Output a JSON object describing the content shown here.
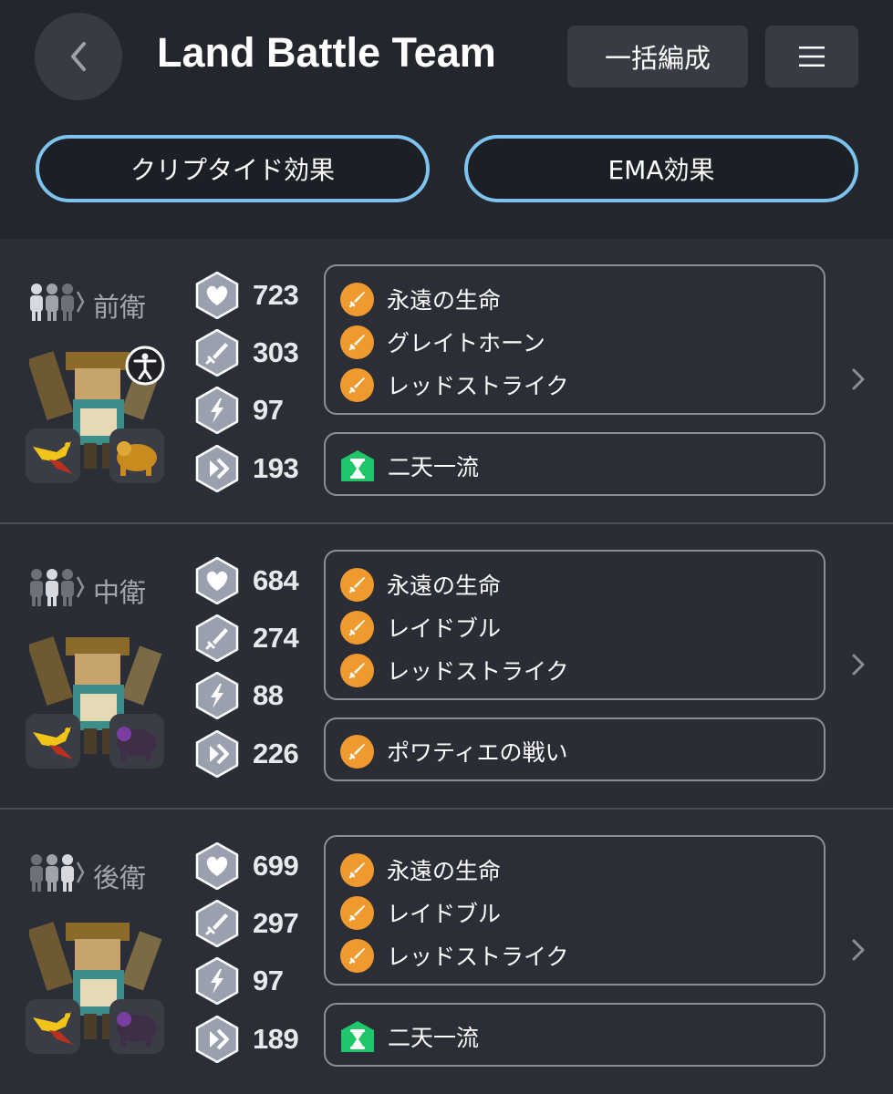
{
  "header": {
    "title": "Land Battle Team",
    "bulk_label": "一括編成",
    "crypto_btn": "クリプタイド効果",
    "ema_btn": "EMA効果"
  },
  "rows": [
    {
      "position": "前衛",
      "stats": {
        "hp": "723",
        "atk": "303",
        "skill": "97",
        "speed": "193"
      },
      "skills": [
        "永遠の生命",
        "グレイトホーン",
        "レッドストライク"
      ],
      "special": {
        "type": "hourglass",
        "name": "二天一流"
      }
    },
    {
      "position": "中衛",
      "stats": {
        "hp": "684",
        "atk": "274",
        "skill": "88",
        "speed": "226"
      },
      "skills": [
        "永遠の生命",
        "レイドブル",
        "レッドストライク"
      ],
      "special": {
        "type": "sword",
        "name": "ポワティエの戦い"
      }
    },
    {
      "position": "後衛",
      "stats": {
        "hp": "699",
        "atk": "297",
        "skill": "97",
        "speed": "189"
      },
      "skills": [
        "永遠の生命",
        "レイドブル",
        "レッドストライク"
      ],
      "special": {
        "type": "hourglass",
        "name": "二天一流"
      }
    }
  ],
  "colors": {
    "background": "#2b2e36",
    "header_bg": "#23262d",
    "accent_outline": "#7dc3ee",
    "skill_orange": "#ef9a2e",
    "special_green": "#1fc66a",
    "stat_hex": "#9aa0ad"
  },
  "icons": [
    "back-arrow-icon",
    "menu-icon",
    "heart-icon",
    "sword-icon",
    "lightning-icon",
    "speed-icon",
    "hourglass-icon",
    "chevron-right-icon",
    "accessibility-icon"
  ]
}
